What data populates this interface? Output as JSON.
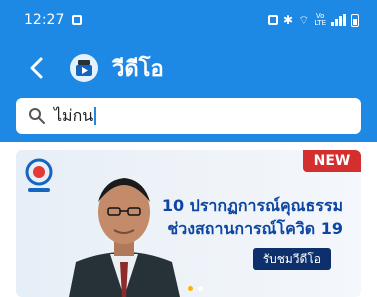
{
  "status_bar": {
    "time": "12:27"
  },
  "header": {
    "title": "วีดีโอ"
  },
  "search": {
    "value": "ไม่กน"
  },
  "banner": {
    "badge": "NEW",
    "headline_line1": "10 ปรากฏการณ์คุณธรรม",
    "headline_line2": "ช่วงสถานการณ์โควิด 19",
    "button_label": "รับชมวีดีโอ"
  },
  "colors": {
    "appbar": "#1e88e5",
    "badge": "#d32f2f",
    "headline": "#0d47a1"
  },
  "icons": [
    "back-arrow-icon",
    "video-logo-icon",
    "search-icon"
  ]
}
